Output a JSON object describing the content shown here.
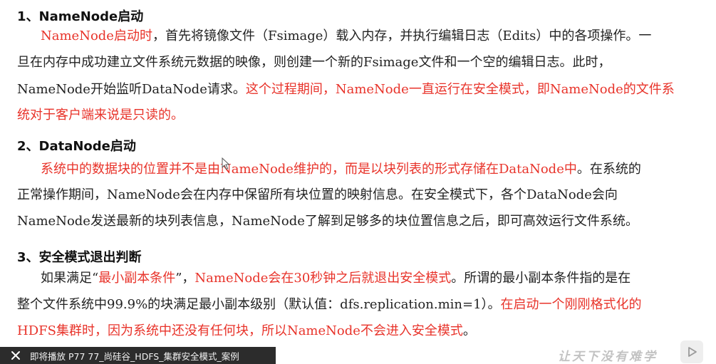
{
  "sections": [
    {
      "heading": "1、NameNode启动",
      "lines": [
        [
          [
            "NameNode启动时",
            true
          ],
          [
            "，首先将镜像文件（Fsimage）载入内存，并执行编辑日志（Edits）中的各项操作。一",
            false
          ]
        ],
        [
          [
            "旦在内存中成功建立文件系统元数据的映像，则创建一个新的Fsimage文件和一个空的编辑日志。此时，",
            false
          ]
        ],
        [
          [
            "NameNode开始监听DataNode请求。",
            false
          ],
          [
            "这个过程期间，NameNode一直运行在安全模式，即NameNode的文件系",
            true
          ]
        ],
        [
          [
            "统对于客户端来说是只读的。",
            true
          ]
        ]
      ]
    },
    {
      "heading": "2、DataNode启动",
      "lines": [
        [
          [
            "系统中的数据块的位置并不是由NameNode维护的，而是以块列表的形式存储在DataNode中",
            true
          ],
          [
            "。在系统的",
            false
          ]
        ],
        [
          [
            "正常操作期间，NameNode会在内存中保留所有块位置的映射信息。在安全模式下，各个DataNode会向",
            false
          ]
        ],
        [
          [
            "NameNode发送最新的块列表信息，NameNode了解到足够多的块位置信息之后，即可高效运行文件系统。",
            false
          ]
        ]
      ]
    },
    {
      "heading": "3、安全模式退出判断",
      "lines": [
        [
          [
            "如果满足“",
            false
          ],
          [
            "最小副本条件",
            true
          ],
          [
            "”，",
            false
          ],
          [
            "NameNode会在30秒钟之后就退出安全模式",
            true
          ],
          [
            "。所谓的最小副本条件指的是在",
            false
          ]
        ],
        [
          [
            "整个文件系统中99.9%的块满足最小副本级别（默认值：dfs.replication.min=1）。",
            false
          ],
          [
            "在启动一个刚刚格式化的",
            true
          ]
        ],
        [
          [
            "HDFS集群时，因为系统中还没有任何块，所以NameNode不会进入安全模式",
            true
          ],
          [
            "。",
            false
          ]
        ]
      ]
    }
  ],
  "overlay": {
    "text": "即将播放 P77 77_尚硅谷_HDFS_集群安全模式_案例",
    "close_icon": "close-icon"
  },
  "watermark": "让天下没有难学",
  "play_icon": "play-icon"
}
